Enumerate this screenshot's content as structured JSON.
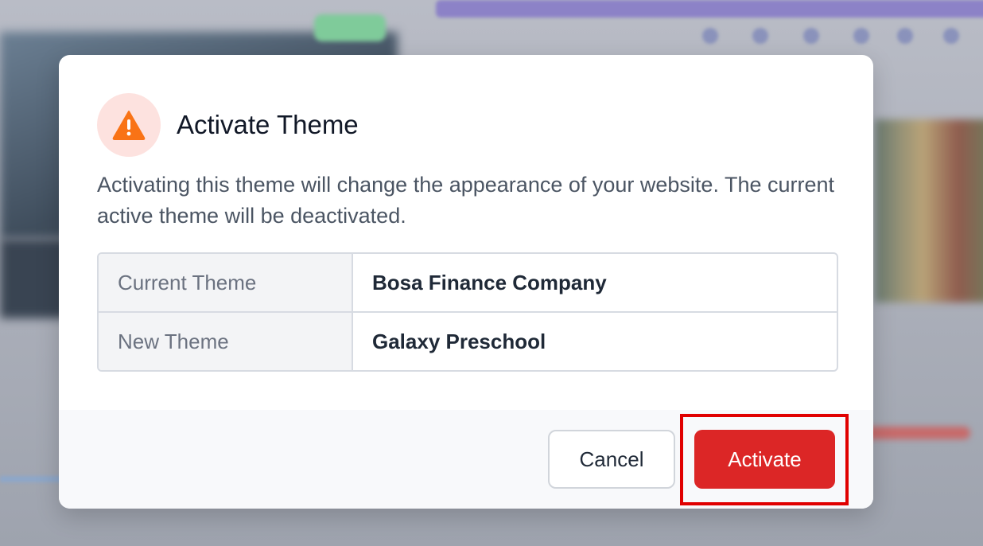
{
  "dialog": {
    "title": "Activate Theme",
    "message": "Activating this theme will change the appearance of your website. The current active theme will be deactivated.",
    "icon": "warning-icon",
    "rows": [
      {
        "label": "Current Theme",
        "value": "Bosa Finance Company"
      },
      {
        "label": "New Theme",
        "value": "Galaxy Preschool"
      }
    ],
    "buttons": {
      "cancel_label": "Cancel",
      "activate_label": "Activate"
    }
  },
  "colors": {
    "danger": "#dc2626",
    "warning_icon": "#f97316",
    "warning_bg": "#fde2df",
    "highlight": "#e00000"
  }
}
